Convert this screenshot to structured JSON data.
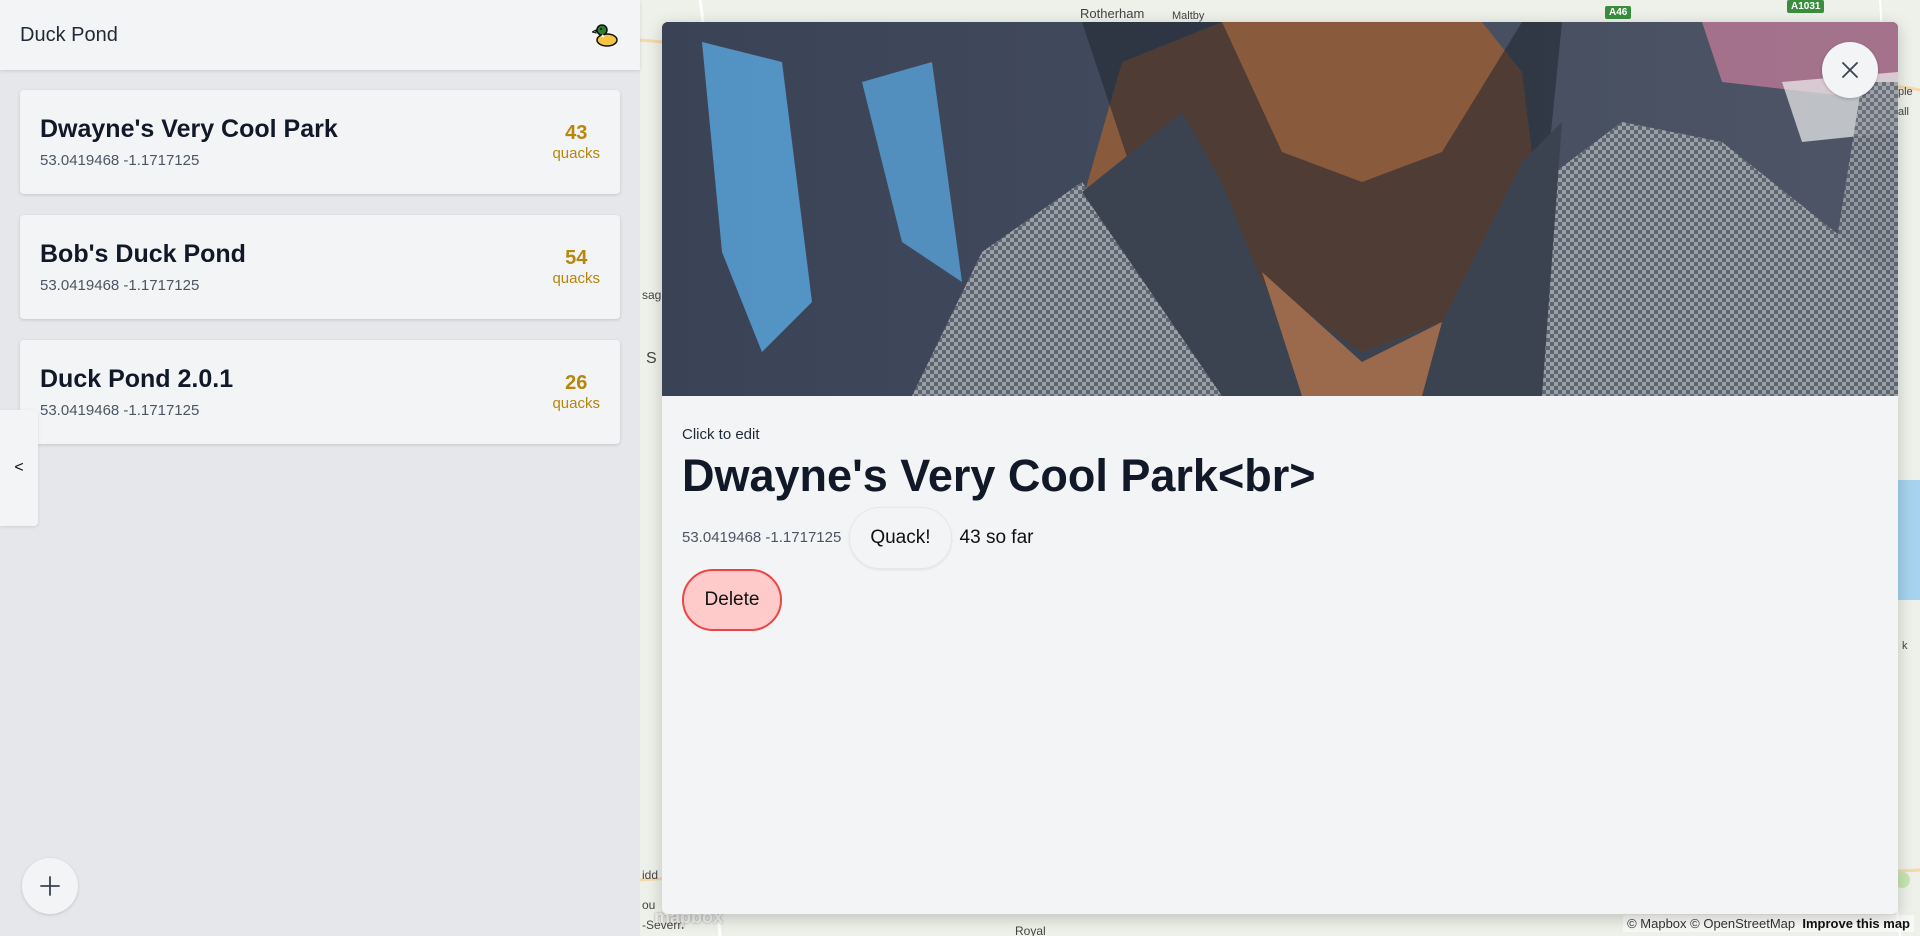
{
  "header": {
    "title": "Duck Pond",
    "icon": "duck-icon"
  },
  "ponds": [
    {
      "name": "Dwayne's Very Cool Park",
      "coords": "53.0419468 -1.1717125",
      "count": "43",
      "unit": "quacks"
    },
    {
      "name": "Bob's Duck Pond",
      "coords": "53.0419468 -1.1717125",
      "count": "54",
      "unit": "quacks"
    },
    {
      "name": "Duck Pond 2.0.1",
      "coords": "53.0419468 -1.1717125",
      "count": "26",
      "unit": "quacks"
    }
  ],
  "sidebar": {
    "collapse_label": "<",
    "add_icon": "plus-icon"
  },
  "map": {
    "labels": [
      "Rotherham",
      "Maltby",
      "sag",
      "S",
      "idd",
      "ou",
      "-Severn",
      "Royal",
      "ple",
      "all",
      "k"
    ],
    "roads": [
      "A46",
      "A1031"
    ],
    "logo": "mapbox",
    "attribution": "© Mapbox © OpenStreetMap",
    "improve": "Improve this map"
  },
  "detail": {
    "edit_hint": "Click to edit",
    "title": "Dwayne's Very Cool Park<br>",
    "coords": "53.0419468 -1.1717125",
    "quack_label": "Quack!",
    "so_far": "43 so far",
    "delete_label": "Delete",
    "close_icon": "close-icon"
  },
  "colors": {
    "accent": "#b7860b",
    "danger": "#ef4444",
    "danger_bg": "#fecaca"
  }
}
